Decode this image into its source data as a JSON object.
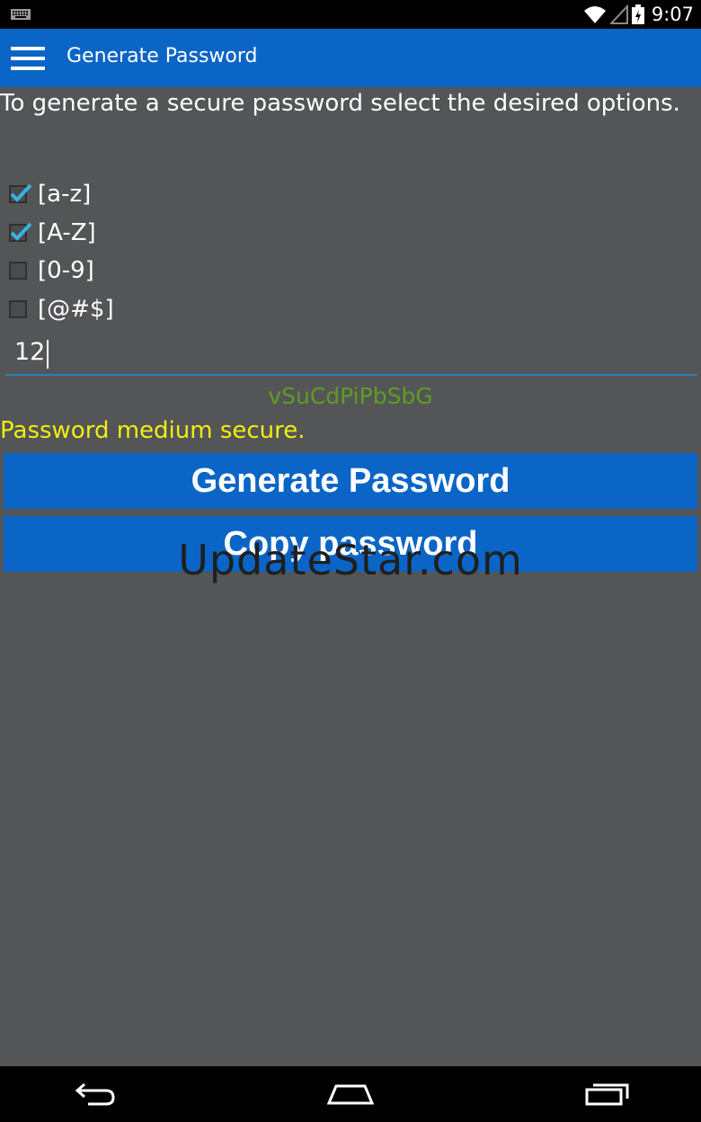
{
  "status_bar": {
    "time": "9:07",
    "icons": [
      "keyboard-icon",
      "wifi-icon",
      "signal-icon",
      "battery-icon"
    ]
  },
  "app_bar": {
    "title": "Generate Password",
    "menu_icon": "hamburger-menu-icon",
    "background": "#0b65c6"
  },
  "intro_text": "To generate a secure password select the desired options.",
  "options": [
    {
      "label": "[a-z]",
      "checked": true
    },
    {
      "label": "[A-Z]",
      "checked": true
    },
    {
      "label": "[0-9]",
      "checked": false
    },
    {
      "label": "[@#$]",
      "checked": false
    }
  ],
  "length_field": {
    "value": "12"
  },
  "generated_password": "vSuCdPiPbSbG",
  "strength_text": "Password medium secure.",
  "buttons": {
    "generate_label": "Generate Password",
    "copy_label": "Copy password"
  },
  "watermark": "UpdateStar.com",
  "nav_bar": {
    "icons": [
      "back-icon",
      "home-icon",
      "recent-apps-icon"
    ]
  },
  "colors": {
    "accent": "#0b65c6",
    "background": "#545557",
    "password_text": "#5f9d22",
    "strength_text": "#f1ee10",
    "checkmark": "#33b5e5"
  }
}
